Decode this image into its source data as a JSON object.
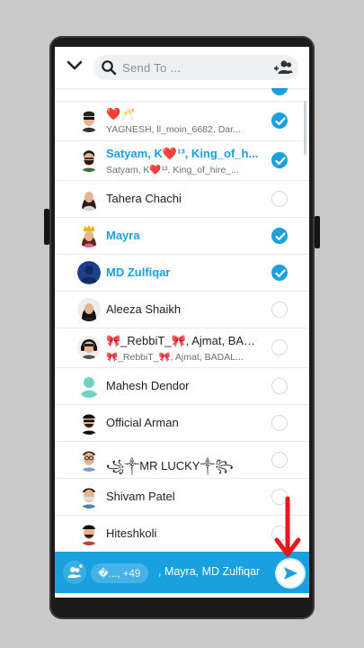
{
  "search": {
    "placeholder": "Send To ..."
  },
  "contacts": [
    {
      "name": "",
      "subtitle": "",
      "selected": true,
      "highlight": false,
      "avatar": "bitmoji-partial"
    },
    {
      "name": "❤️🥂",
      "subtitle": "YAGNESH, ll_moin_6682, Dar...",
      "selected": true,
      "highlight": false,
      "avatar": "bitmoji-sunglasses"
    },
    {
      "name": "Satyam, K❤️¹³, King_of_h...",
      "subtitle": "Satyam, K❤️¹³, King_of_hire_...",
      "selected": true,
      "highlight": true,
      "avatar": "bitmoji-beard"
    },
    {
      "name": "Tahera Chachi",
      "subtitle": "",
      "selected": false,
      "highlight": false,
      "avatar": "bitmoji-woman"
    },
    {
      "name": "Mayra",
      "subtitle": "",
      "selected": true,
      "highlight": true,
      "avatar": "bitmoji-crown"
    },
    {
      "name": "MD Zulfiqar",
      "subtitle": "",
      "selected": true,
      "highlight": true,
      "avatar": "default-person"
    },
    {
      "name": "Aleeza Shaikh",
      "subtitle": "",
      "selected": false,
      "highlight": false,
      "avatar": "bitmoji-woman-dark"
    },
    {
      "name": "🎀_RebbiT_🎀, Ajmat, BAD...",
      "subtitle": "🎀_RebbiT_🎀, Ajmat, BADAL...",
      "selected": false,
      "highlight": false,
      "avatar": "bitmoji-headphones"
    },
    {
      "name": "Mahesh Dendor",
      "subtitle": "",
      "selected": false,
      "highlight": false,
      "avatar": "default-person-teal"
    },
    {
      "name": "Official Arman",
      "subtitle": "",
      "selected": false,
      "highlight": false,
      "avatar": "bitmoji-cap"
    },
    {
      "name": "꧁༒MR LUCKY༒꧂",
      "subtitle": "",
      "selected": false,
      "highlight": false,
      "avatar": "bitmoji-glasses"
    },
    {
      "name": "Shivam Patel",
      "subtitle": "",
      "selected": false,
      "highlight": false,
      "avatar": "bitmoji-mask"
    },
    {
      "name": "Hiteshkoli",
      "subtitle": "",
      "selected": false,
      "highlight": false,
      "avatar": "bitmoji-cap-red"
    }
  ],
  "bottom_bar": {
    "chip_text": "�..., +49",
    "selected_names": ", Mayra, MD Zulfiqar"
  },
  "icons": {
    "collapse": "chevron-down-icon",
    "search": "search-icon",
    "add_group": "add-friends-icon",
    "group": "group-icon",
    "send": "send-arrow-icon",
    "annotation": "red-arrow-icon"
  },
  "colors": {
    "accent": "#1aa0de",
    "bottom_bar": "#1aa0de",
    "annotation_arrow": "#e8171d"
  }
}
